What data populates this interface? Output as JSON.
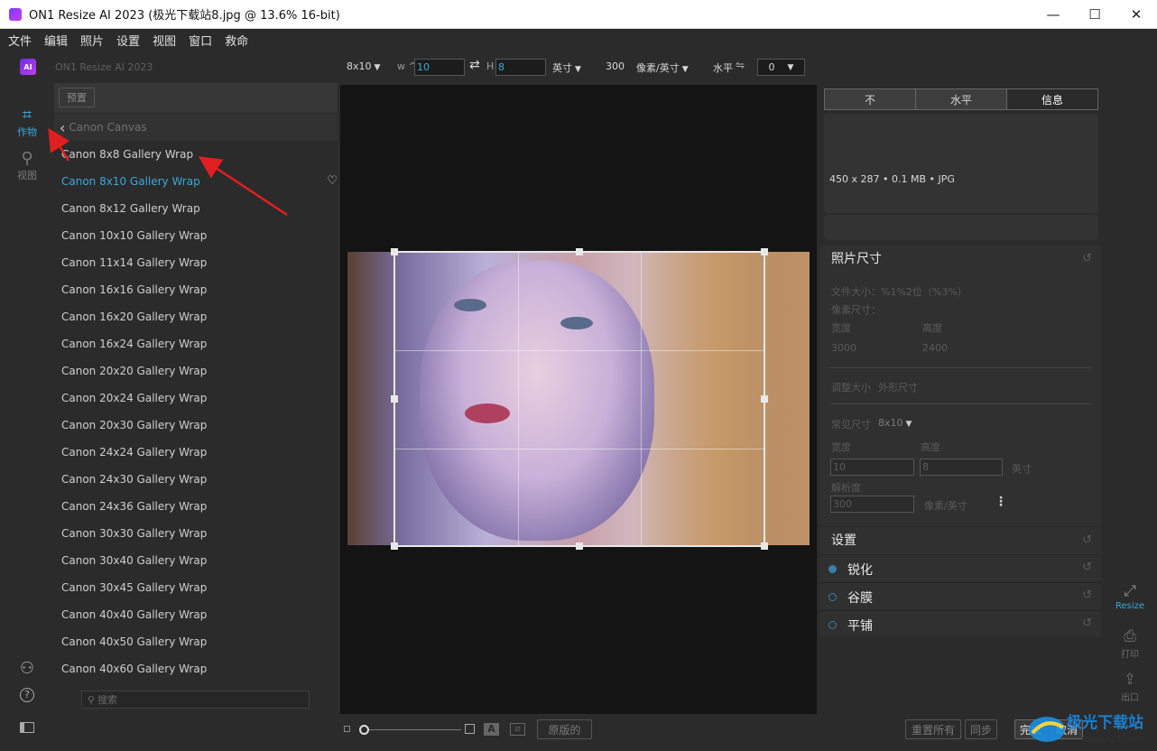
{
  "window": {
    "title": "ON1 Resize AI 2023 (极光下载站8.jpg @ 13.6% 16-bit)",
    "minimize": "—",
    "maximize": "☐",
    "close": "✕"
  },
  "menu": [
    "文件",
    "编辑",
    "照片",
    "设置",
    "视图",
    "窗口",
    "救命"
  ],
  "options": {
    "brand_badge": "AI",
    "app_name": "ON1 Resize AI 2023",
    "preset_size": "8x10",
    "w_label": "w",
    "w_value": "10",
    "h_label": "H",
    "h_value": "8",
    "unit": "英寸",
    "resolution": "300",
    "res_unit": "像素/英寸",
    "level_label": "水平",
    "level_value": "0"
  },
  "rail": {
    "crop_label": "作物",
    "view_label": "视图",
    "help_icon": "?"
  },
  "presets": {
    "tab_label": "预置",
    "breadcrumb": "Canon Canvas",
    "items": [
      "Canon 8x8 Gallery Wrap",
      "Canon 8x10 Gallery Wrap",
      "Canon 8x12 Gallery Wrap",
      "Canon 10x10 Gallery Wrap",
      "Canon 11x14 Gallery Wrap",
      "Canon 16x16 Gallery Wrap",
      "Canon 16x20 Gallery Wrap",
      "Canon 16x24 Gallery Wrap",
      "Canon 20x20 Gallery Wrap",
      "Canon 20x24 Gallery Wrap",
      "Canon 20x30 Gallery Wrap",
      "Canon 24x24 Gallery Wrap",
      "Canon 24x30 Gallery Wrap",
      "Canon 24x36 Gallery Wrap",
      "Canon 30x30 Gallery Wrap",
      "Canon 30x40 Gallery Wrap",
      "Canon 30x45 Gallery Wrap",
      "Canon 40x40 Gallery Wrap",
      "Canon 40x50 Gallery Wrap",
      "Canon 40x60 Gallery Wrap"
    ],
    "active_index": 1,
    "search_placeholder": "搜索"
  },
  "bottom": {
    "aa_label": "A",
    "original_button": "原版的",
    "reset_all_button": "重置所有",
    "sync_button": "同步",
    "done_button": "完成",
    "cancel_button": "取消"
  },
  "right": {
    "tabs": [
      "不",
      "水平",
      "信息"
    ],
    "active_tab": 2,
    "file_meta": "450 x 287 • 0.1 MB • JPG",
    "photo_size": {
      "header": "照片尺寸",
      "file_size": "文件大小：%1%2位（%3%）",
      "pixel_size": "像素尺寸：",
      "width_label": "宽度",
      "height_label": "高度",
      "width_value": "3000",
      "height_value": "2400",
      "resize_label": "调整大小",
      "shape_label": "外形尺寸",
      "common_size_label": "常见尺寸",
      "common_size_value": "8x10",
      "w2_label": "宽度",
      "h2_label": "高度",
      "w2_value": "10",
      "h2_value": "8",
      "unit": "英寸",
      "resolution_label": "解析度",
      "resolution_value": "300",
      "res_unit": "像素/英寸",
      "more": "⋮"
    },
    "settings_header": "设置",
    "settings": [
      "锐化",
      "谷膜",
      "平铺"
    ]
  },
  "modules": {
    "resize_label": "Resize",
    "print_label": "打印",
    "export_label": "出口"
  },
  "watermark": {
    "text": "极光下载站",
    "url": "www.xz7.com"
  },
  "colors": {
    "accent": "#3aa8d8",
    "annotation": "#e02020",
    "done": "#2f8f2f",
    "cancel": "#c03030"
  }
}
